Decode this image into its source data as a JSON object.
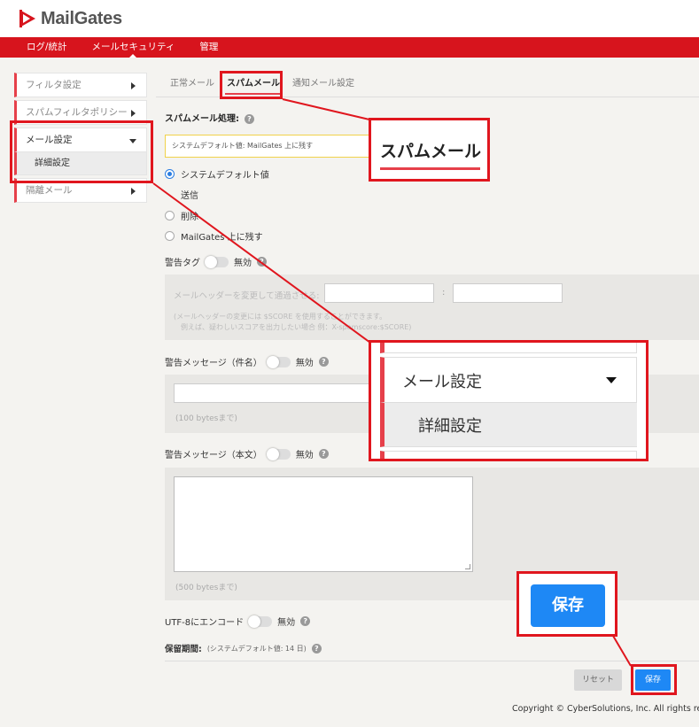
{
  "brand": {
    "name": "MailGates"
  },
  "nav": {
    "items": [
      {
        "label": "ログ/統計"
      },
      {
        "label": "メールセキュリティ"
      },
      {
        "label": "管理"
      }
    ]
  },
  "sidebar": {
    "items": [
      {
        "label": "フィルタ設定"
      },
      {
        "label": "スパムフィルタポリシー"
      },
      {
        "label": "メール設定"
      },
      {
        "label": "隔離メール"
      }
    ],
    "sub_item": "詳細設定"
  },
  "tabs": [
    {
      "label": "正常メール"
    },
    {
      "label": "スパムメール"
    },
    {
      "label": "通知メール設定"
    }
  ],
  "spam": {
    "processing_label": "スパムメール処理:",
    "default_text": "システムデフォルト値: MailGates 上に残す",
    "options": [
      "システムデフォルト値",
      "送信",
      "削除",
      "MailGates 上に残す"
    ]
  },
  "warning_tag": {
    "label": "警告タグ",
    "status": "無効",
    "header_label": "メールヘッダーを変更して通過させる:",
    "separator": ":",
    "note_line1": "(メールヘッダーの変更には $SCORE を使用することができます。",
    "note_line2": "例えば、疑わしいスコアを出力したい場合 例：X-spamscore:$SCORE)"
  },
  "warn_subject": {
    "label": "警告メッセージ（件名）",
    "status": "無効",
    "hint": "(100 bytesまで)"
  },
  "warn_body": {
    "label": "警告メッセージ（本文）",
    "status": "無効",
    "hint": "(500 bytesまで)"
  },
  "utf8": {
    "label": "UTF-8にエンコード",
    "status": "無効"
  },
  "retention": {
    "label": "保留期間:",
    "value": "(システムデフォルト値: 14 日)"
  },
  "buttons": {
    "reset": "リセット",
    "save": "保存"
  },
  "footer": {
    "copyright": "Copyright © CyberSolutions, Inc. All rights re"
  },
  "callouts": {
    "tab_zoom": "スパムメール",
    "menu_zoom_title": "メール設定",
    "menu_zoom_sub": "詳細設定",
    "save_zoom": "保存"
  },
  "colors": {
    "brand_red": "#d7141d",
    "annotation_red": "#e0161e",
    "primary_blue": "#1e88f5"
  }
}
